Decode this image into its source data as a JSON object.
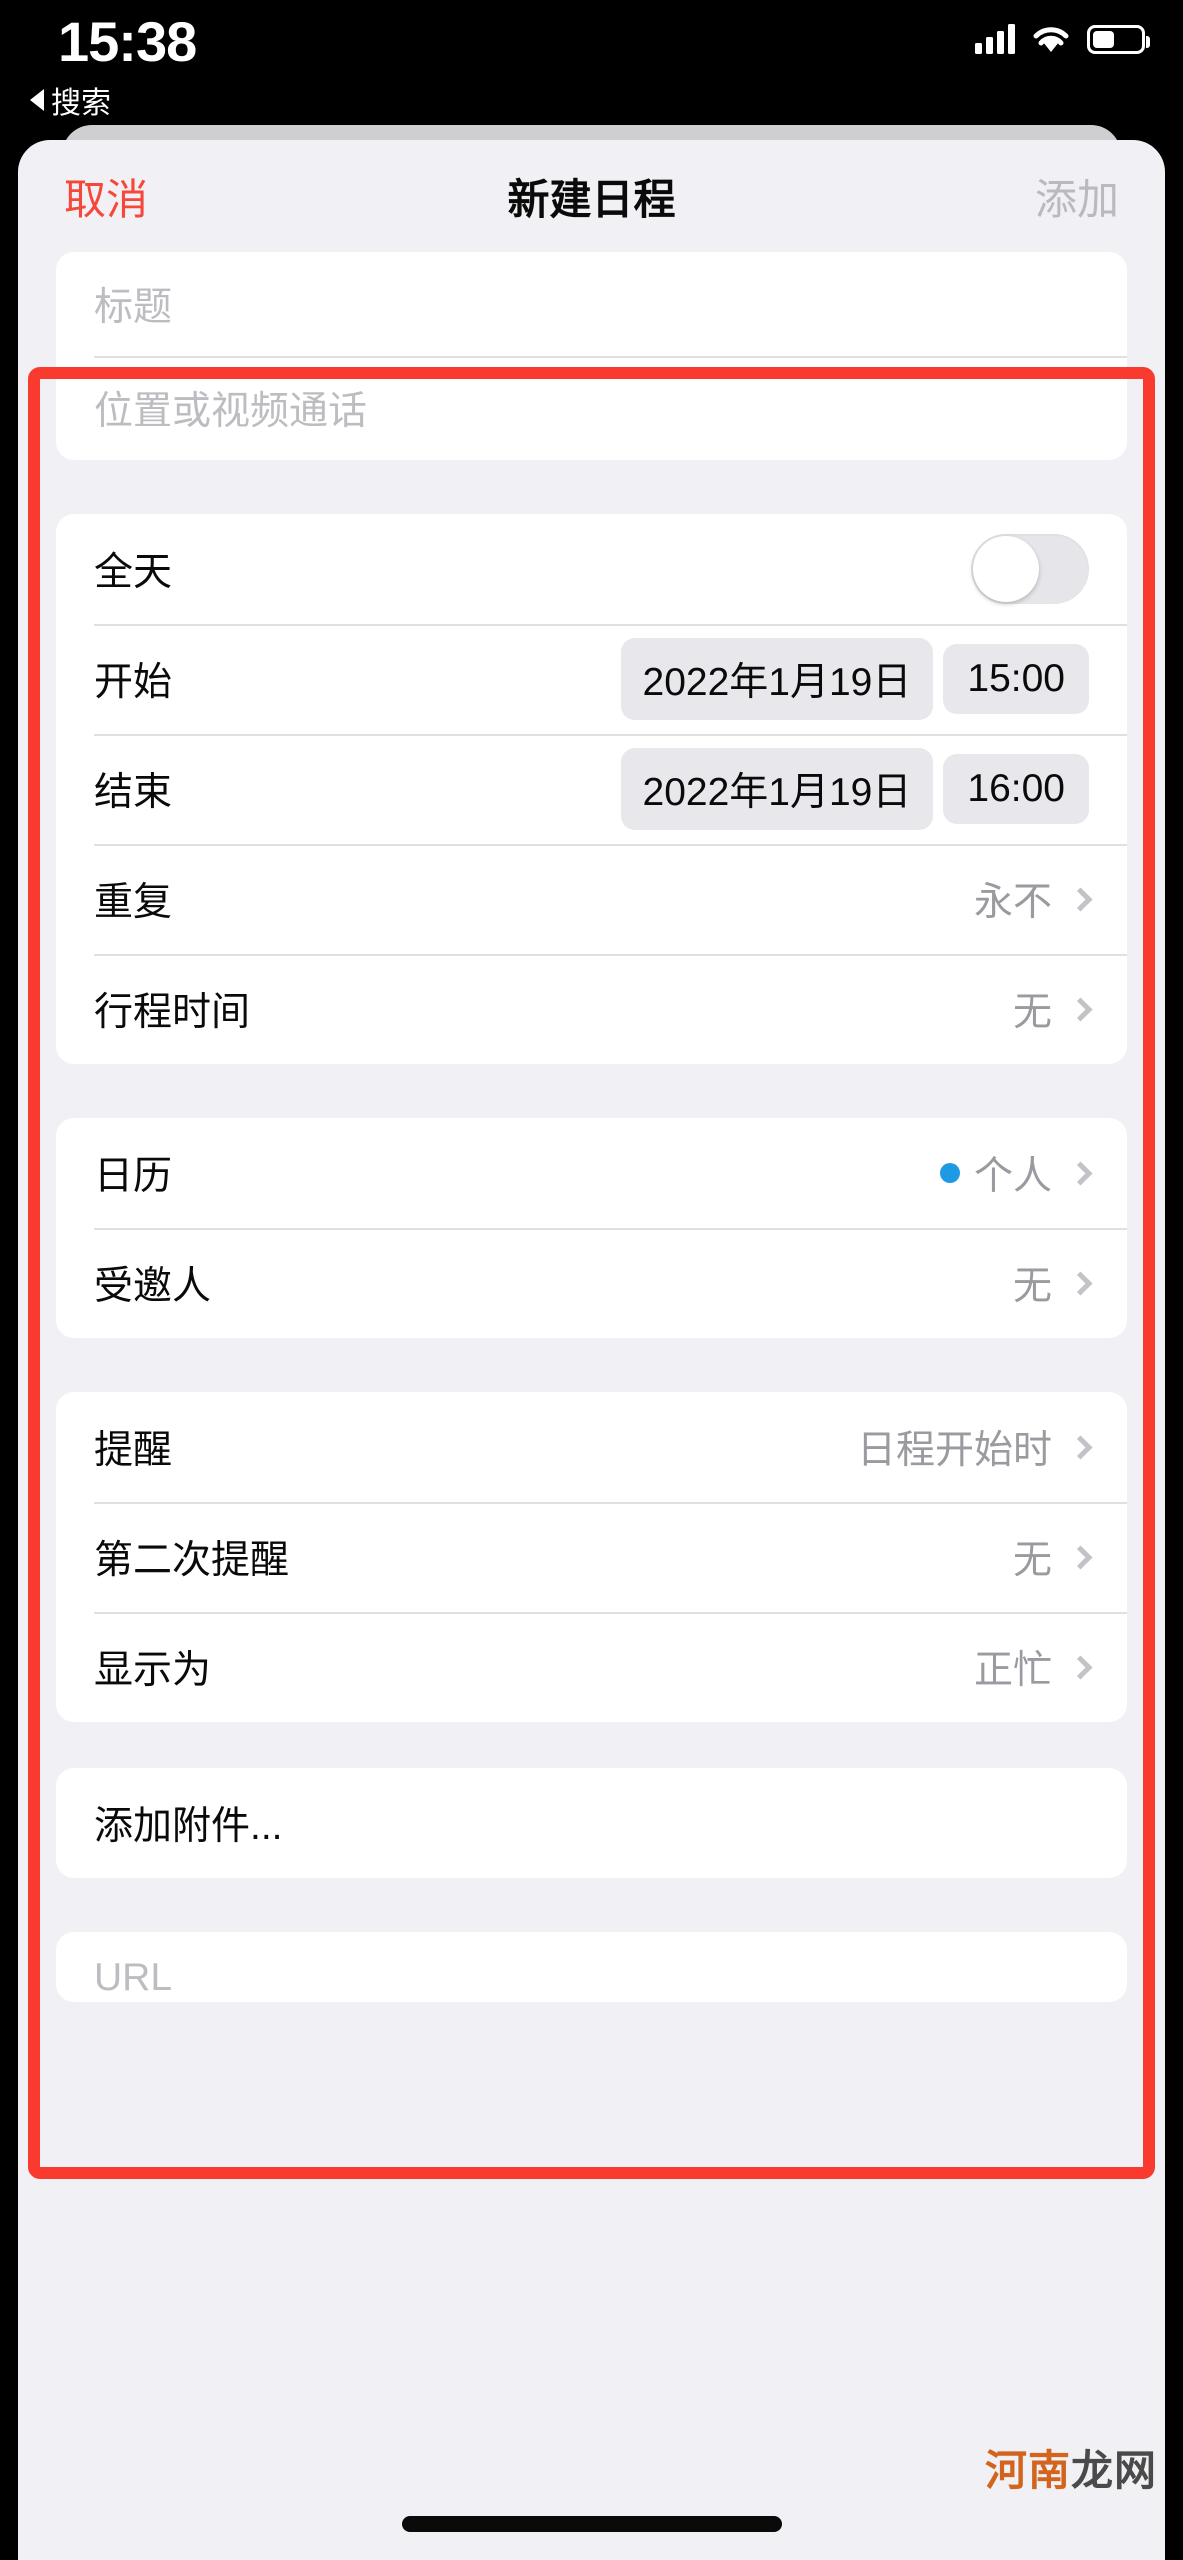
{
  "status_bar": {
    "time": "15:38",
    "back_label": "搜索",
    "back_icon": "triangle-left-icon",
    "signal_icon": "cellular-bars-icon",
    "wifi_icon": "wifi-icon",
    "battery_icon": "battery-icon"
  },
  "nav": {
    "cancel_label": "取消",
    "title": "新建日程",
    "add_label": "添加"
  },
  "fields": {
    "title_placeholder": "标题",
    "location_placeholder": "位置或视频通话"
  },
  "datetime_section": {
    "all_day": {
      "label": "全天",
      "enabled": false
    },
    "start": {
      "label": "开始",
      "date": "2022年1月19日",
      "time": "15:00"
    },
    "end": {
      "label": "结束",
      "date": "2022年1月19日",
      "time": "16:00"
    },
    "repeat": {
      "label": "重复",
      "value": "永不"
    },
    "travel_time": {
      "label": "行程时间",
      "value": "无"
    }
  },
  "calendar_section": {
    "calendar": {
      "label": "日历",
      "value": "个人",
      "dot_color": "#1e9ae4"
    },
    "invitees": {
      "label": "受邀人",
      "value": "无"
    }
  },
  "alert_section": {
    "alert": {
      "label": "提醒",
      "value": "日程开始时"
    },
    "second_alert": {
      "label": "第二次提醒",
      "value": "无"
    },
    "show_as": {
      "label": "显示为",
      "value": "正忙"
    }
  },
  "attachment_section": {
    "add_attachment": {
      "label": "添加附件..."
    }
  },
  "url_section": {
    "url": {
      "label": "URL"
    }
  },
  "annotation": {
    "color": "#f93a2f"
  },
  "watermark": {
    "part1": "河南",
    "part2": "龙网"
  }
}
